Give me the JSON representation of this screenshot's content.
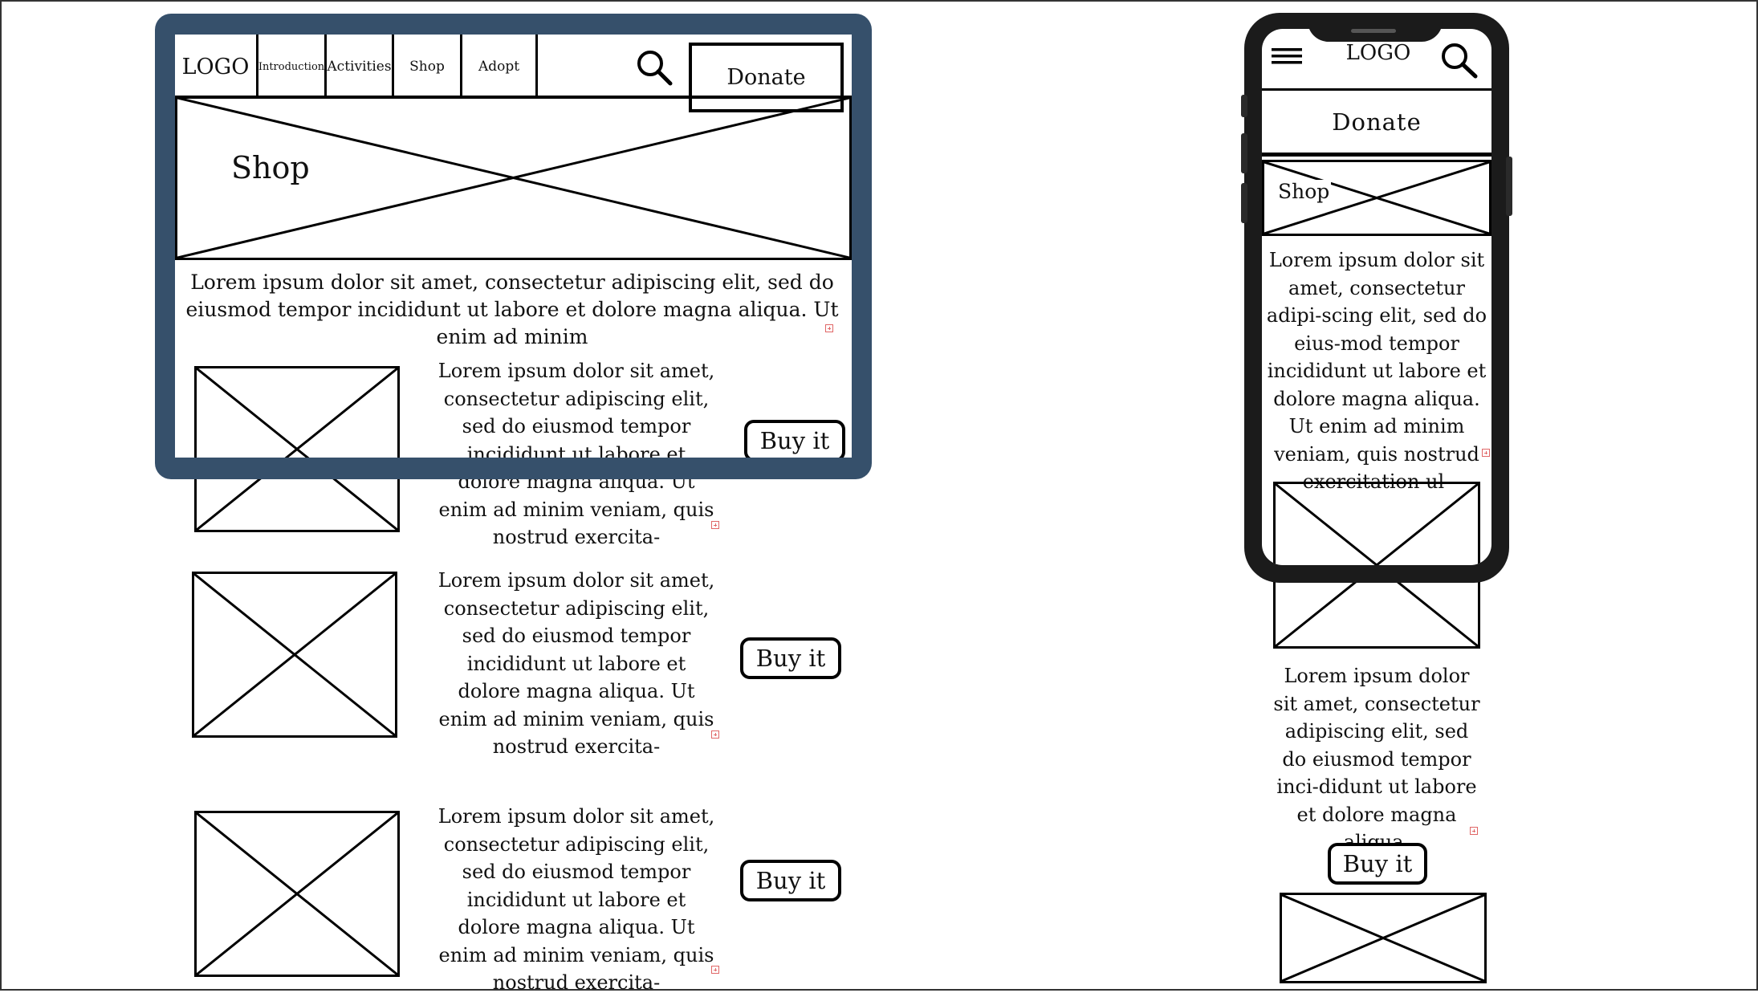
{
  "tablet": {
    "nav": {
      "logo": "LOGO",
      "introduction": "Introduction",
      "activities": "Activities",
      "shop": "Shop",
      "adopt": "Adopt",
      "donate": "Donate"
    },
    "hero_label": "Shop",
    "intro_text": "Lorem ipsum dolor sit amet, consectetur adipiscing elit, sed do eiusmod tempor incididunt ut labore et dolore magna aliqua. Ut enim ad minim",
    "products": [
      {
        "text": "Lorem ipsum dolor sit amet, consectetur adipiscing elit, sed do eiusmod tempor incididunt ut labore et dolore magna aliqua. Ut enim ad minim veniam, quis nostrud exercita-",
        "button": "Buy it"
      },
      {
        "text": "Lorem ipsum dolor sit amet, consectetur adipiscing elit, sed do eiusmod tempor incididunt ut labore et dolore magna aliqua. Ut enim ad minim veniam, quis nostrud exercita-",
        "button": "Buy it"
      },
      {
        "text": "Lorem ipsum dolor sit amet, consectetur adipiscing elit, sed do eiusmod tempor incididunt ut labore et dolore magna aliqua. Ut enim ad minim veniam, quis nostrud exercita-",
        "button": "Buy it"
      }
    ]
  },
  "phone": {
    "logo": "LOGO",
    "donate": "Donate",
    "hero_label": "Shop",
    "intro_text": "Lorem ipsum dolor sit amet, consectetur adipi-scing elit, sed do eius-mod tempor incididunt ut labore et dolore magna aliqua. Ut enim ad minim veniam, quis nostrud exercitation ul-",
    "product_text": "Lorem ipsum dolor sit amet, consectetur adipiscing elit, sed do eiusmod tempor inci-didunt ut labore et dolore magna aliqua.",
    "button": "Buy it"
  },
  "colors": {
    "tablet_frame": "#36506b",
    "phone_frame": "#1b1b1b",
    "overflow_marker": "#e06666",
    "outline": "#000000"
  },
  "icons": [
    "search-icon",
    "hamburger-menu-icon",
    "text-overflow-icon"
  ]
}
